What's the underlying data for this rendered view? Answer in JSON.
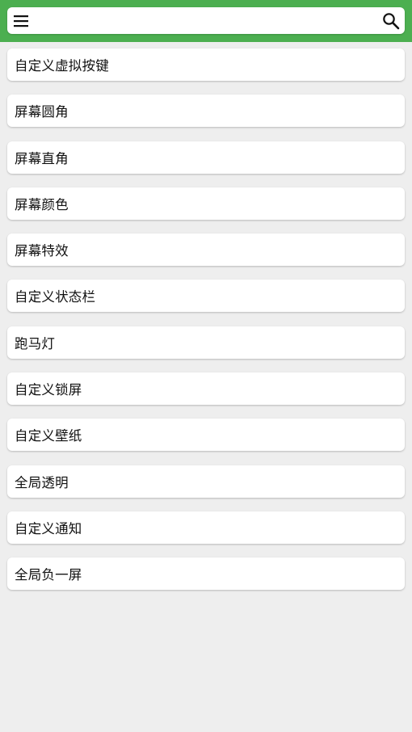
{
  "appbar": {
    "color": "#4caf50",
    "menu_icon": "menu-icon",
    "search_icon": "search-icon",
    "search": {
      "value": "",
      "placeholder": ""
    }
  },
  "list": {
    "items": [
      {
        "label": "自定义虚拟按键"
      },
      {
        "label": "屏幕圆角"
      },
      {
        "label": "屏幕直角"
      },
      {
        "label": "屏幕颜色"
      },
      {
        "label": "屏幕特效"
      },
      {
        "label": "自定义状态栏"
      },
      {
        "label": "跑马灯"
      },
      {
        "label": "自定义锁屏"
      },
      {
        "label": "自定义壁纸"
      },
      {
        "label": "全局透明"
      },
      {
        "label": "自定义通知"
      },
      {
        "label": "全局负一屏"
      }
    ]
  }
}
